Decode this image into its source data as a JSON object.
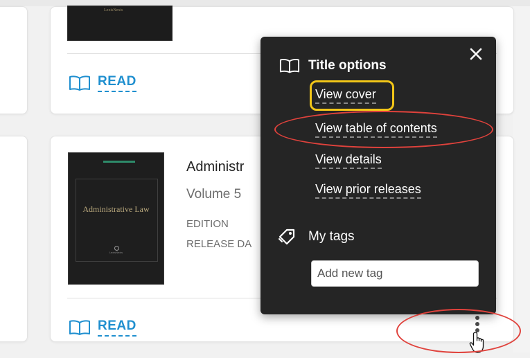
{
  "cards": [
    {
      "read_label": "READ"
    },
    {
      "title": "Administr",
      "volume": "Volume 5",
      "edition_label": "EDITION",
      "release_label": "RELEASE DA",
      "cover": {
        "title": "Administrative Law",
        "brand": "LexisNexis"
      },
      "read_label": "READ"
    }
  ],
  "title_options": {
    "header": "Title options",
    "close_icon": "close-icon",
    "items": [
      {
        "label": "View cover"
      },
      {
        "label": "View table of contents"
      },
      {
        "label": "View details"
      },
      {
        "label": "View prior releases"
      }
    ],
    "tags": {
      "header": "My tags",
      "input_placeholder": "Add new tag"
    }
  },
  "icons": {
    "read": "open-book-icon",
    "tags": "tag-icon",
    "more": "vertical-ellipsis-icon",
    "cursor": "hand-pointer-icon"
  },
  "colors": {
    "link_blue": "#1f8fcf",
    "popover_bg": "#252525",
    "highlight_yellow": "#f2c618",
    "annotation_red": "#e0423c"
  }
}
